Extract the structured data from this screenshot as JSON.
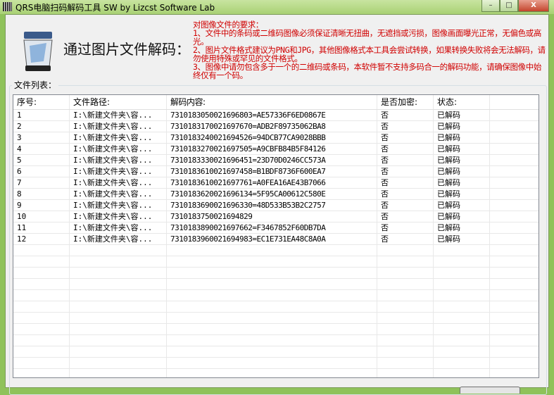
{
  "window": {
    "title": "QRS电脑扫码解码工具 SW  by Lizcst Software Lab",
    "minimize": "–",
    "maximize": "□",
    "close": "X"
  },
  "header": {
    "heading": "通过图片文件解码：",
    "requirements": [
      "对图像文件的要求：",
      "1、文件中的条码或二维码图像必须保证清晰无扭曲，无遮挡或污损，图像画面曝光正常，无偏色或高光。",
      "2、图片文件格式建议为PNG和JPG，其他图像格式本工具会尝试转换，如果转换失败将会无法解码，请勿使用特殊或罕见的文件格式。",
      "3、图像中请勿包含多于一个的二维码或条码，本软件暂不支持多码合一的解码功能，请确保图像中始终仅有一个码。"
    ]
  },
  "file_list": {
    "label": "文件列表：",
    "columns": [
      "序号:",
      "文件路径:",
      "解码内容:",
      "是否加密:",
      "状态:"
    ],
    "rows": [
      [
        "1",
        "I:\\新建文件夹\\容...",
        "7310183050021696803=AE57336F6ED0867E",
        "否",
        "已解码"
      ],
      [
        "2",
        "I:\\新建文件夹\\容...",
        "7310183170021697670=ADB2F89735062BA8",
        "否",
        "已解码"
      ],
      [
        "3",
        "I:\\新建文件夹\\容...",
        "7310183240021694526=94DCB77CA9028BBB",
        "否",
        "已解码"
      ],
      [
        "4",
        "I:\\新建文件夹\\容...",
        "7310183270021697505=A9CBFB84B5F84126",
        "否",
        "已解码"
      ],
      [
        "5",
        "I:\\新建文件夹\\容...",
        "7310183330021696451=23D70D0246CC573A",
        "否",
        "已解码"
      ],
      [
        "6",
        "I:\\新建文件夹\\容...",
        "7310183610021697458=B1BDF8736F600EA7",
        "否",
        "已解码"
      ],
      [
        "7",
        "I:\\新建文件夹\\容...",
        "7310183610021697761=A0FEA16AE43B7066",
        "否",
        "已解码"
      ],
      [
        "8",
        "I:\\新建文件夹\\容...",
        "7310183620021696134=5F95CA00612C580E",
        "否",
        "已解码"
      ],
      [
        "9",
        "I:\\新建文件夹\\容...",
        "7310183690021696330=48D533B53B2C2757",
        "否",
        "已解码"
      ],
      [
        "10",
        "I:\\新建文件夹\\容...",
        "7310183750021694829",
        "否",
        "已解码"
      ],
      [
        "11",
        "I:\\新建文件夹\\容...",
        "7310183890021697662=F3467852F60DB7DA",
        "否",
        "已解码"
      ],
      [
        "12",
        "I:\\新建文件夹\\容...",
        "7310183960021694983=EC1E731EA48C8A0A",
        "否",
        "已解码"
      ]
    ]
  }
}
